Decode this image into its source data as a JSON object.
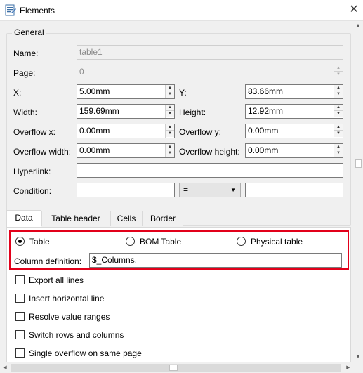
{
  "window": {
    "title": "Elements",
    "app_icon": "document-icon",
    "close_icon": "close-icon"
  },
  "general": {
    "title": "General",
    "name": {
      "label": "Name:",
      "value": "table1"
    },
    "page": {
      "label": "Page:",
      "value": "0"
    },
    "x": {
      "label": "X:",
      "value": "5.00mm"
    },
    "y": {
      "label": "Y:",
      "value": "83.66mm"
    },
    "width": {
      "label": "Width:",
      "value": "159.69mm"
    },
    "height": {
      "label": "Height:",
      "value": "12.92mm"
    },
    "overflow_x": {
      "label": "Overflow x:",
      "value": "0.00mm"
    },
    "overflow_y": {
      "label": "Overflow y:",
      "value": "0.00mm"
    },
    "overflow_width": {
      "label": "Overflow width:",
      "value": "0.00mm"
    },
    "overflow_height": {
      "label": "Overflow height:",
      "value": "0.00mm"
    },
    "hyperlink": {
      "label": "Hyperlink:",
      "value": ""
    },
    "condition": {
      "label": "Condition:",
      "left": "",
      "operator": "=",
      "right": ""
    }
  },
  "tabs": [
    {
      "label": "Data",
      "active": true
    },
    {
      "label": "Table header",
      "active": false
    },
    {
      "label": "Cells",
      "active": false
    },
    {
      "label": "Border",
      "active": false
    }
  ],
  "data_tab": {
    "radios": [
      {
        "label": "Table",
        "selected": true
      },
      {
        "label": "BOM Table",
        "selected": false
      },
      {
        "label": "Physical table",
        "selected": false
      }
    ],
    "column_definition": {
      "label": "Column definition:",
      "value": "$_Columns."
    },
    "checkboxes": [
      {
        "label": "Export all lines",
        "checked": false
      },
      {
        "label": "Insert horizontal line",
        "checked": false
      },
      {
        "label": "Resolve value ranges",
        "checked": false
      },
      {
        "label": "Switch rows and columns",
        "checked": false
      },
      {
        "label": "Single overflow on same page",
        "checked": false
      }
    ]
  },
  "colors": {
    "highlight_border": "#e2001a"
  }
}
